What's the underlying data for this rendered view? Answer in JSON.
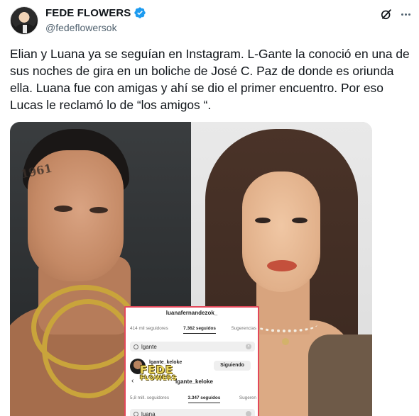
{
  "author": {
    "display_name": "FEDE FLOWERS",
    "handle": "@fedeflowersok",
    "verified": true
  },
  "header_icons": [
    "grok-icon",
    "more-icon"
  ],
  "tweet": {
    "text": "Elian y Luana ya se seguían en Instagram. L-Gante la conoció en una de sus noches de gira en un boliche de José C. Paz de donde es oriunda ella. Luana fue con amigas y ahí se dio el primer encuentro. Por eso Lucas le reclamó lo de “los amigos “."
  },
  "media": {
    "left_tattoo": "1961",
    "instagram": {
      "profile_username": "luanafernandezok_",
      "tabs_top": [
        "414 mil seguidores",
        "7.362 seguidos",
        "Sugerencias"
      ],
      "search_top": "lgante",
      "result_handle": "lgante_keloke",
      "result_button": "Siguiendo",
      "back_profile": "lgante_keloke",
      "tabs_bottom": [
        "5,8 mill. seguidores",
        "3.347 seguidos",
        "Sugeren"
      ],
      "search_bottom": "luana",
      "watermark_line1": "FEDE",
      "watermark_line2": "FLOWERS"
    }
  },
  "colors": {
    "verified_blue": "#1d9bf0",
    "text_primary": "#0f1419",
    "text_secondary": "#536471",
    "overlay_border": "#e3485a"
  }
}
